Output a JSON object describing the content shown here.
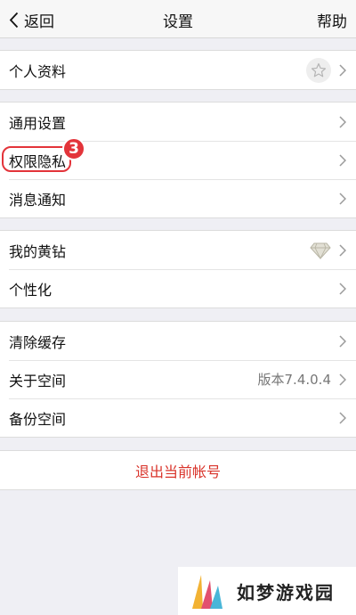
{
  "nav": {
    "back_label": "返回",
    "title": "设置",
    "help_label": "帮助"
  },
  "groups": {
    "profile": {
      "label": "个人资料",
      "icon": "star-icon"
    },
    "general": {
      "items": [
        {
          "label": "通用设置"
        },
        {
          "label": "权限隐私",
          "badge": "3"
        },
        {
          "label": "消息通知"
        }
      ]
    },
    "vip": {
      "items": [
        {
          "label": "我的黄钻",
          "icon": "diamond-icon"
        },
        {
          "label": "个性化"
        }
      ]
    },
    "storage": {
      "items": [
        {
          "label": "清除缓存"
        },
        {
          "label": "关于空间",
          "value": "版本7.4.0.4"
        },
        {
          "label": "备份空间"
        }
      ]
    }
  },
  "logout_label": "退出当前帐号",
  "watermark": {
    "text": "如梦游戏园"
  },
  "colors": {
    "accent_red": "#e3343a",
    "logout_red": "#d9342b",
    "background": "#efeff4"
  }
}
